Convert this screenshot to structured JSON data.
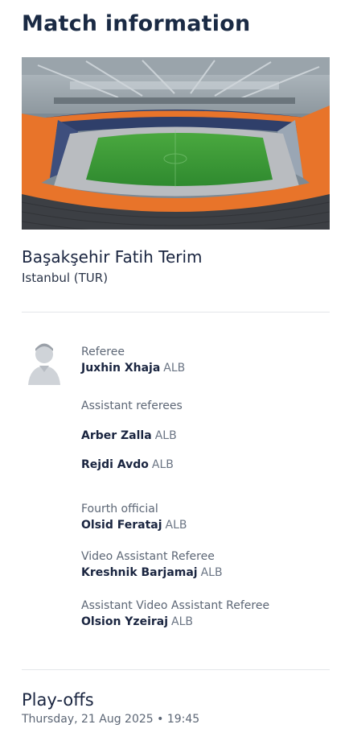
{
  "header": {
    "title": "Match information"
  },
  "venue": {
    "image_alt": "stadium-photo",
    "name": "Başakşehir Fatih Terim",
    "city": "Istanbul (TUR)"
  },
  "officials": {
    "referee": {
      "role": "Referee",
      "name": "Juxhin Xhaja",
      "nat": "ALB"
    },
    "assistants": {
      "role": "Assistant referees",
      "people": [
        {
          "name": "Arber Zalla",
          "nat": "ALB"
        },
        {
          "name": "Rejdi Avdo",
          "nat": "ALB"
        }
      ]
    },
    "fourth": {
      "role": "Fourth official",
      "name": "Olsid Ferataj",
      "nat": "ALB"
    },
    "var": {
      "role": "Video Assistant Referee",
      "name": "Kreshnik Barjamaj",
      "nat": "ALB"
    },
    "avar": {
      "role": "Assistant Video Assistant Referee",
      "name": "Olsion Yzeiraj",
      "nat": "ALB"
    }
  },
  "match": {
    "stage": "Play-offs",
    "datetime": "Thursday, 21 Aug 2025 • 19:45"
  },
  "colors": {
    "text_dark": "#1a2540",
    "text_muted": "#5c6675",
    "divider": "#e3e6ea",
    "pitch": "#3d9a3a",
    "seats": "#e8742a"
  },
  "icons": {
    "avatar": "person-silhouette-icon"
  }
}
